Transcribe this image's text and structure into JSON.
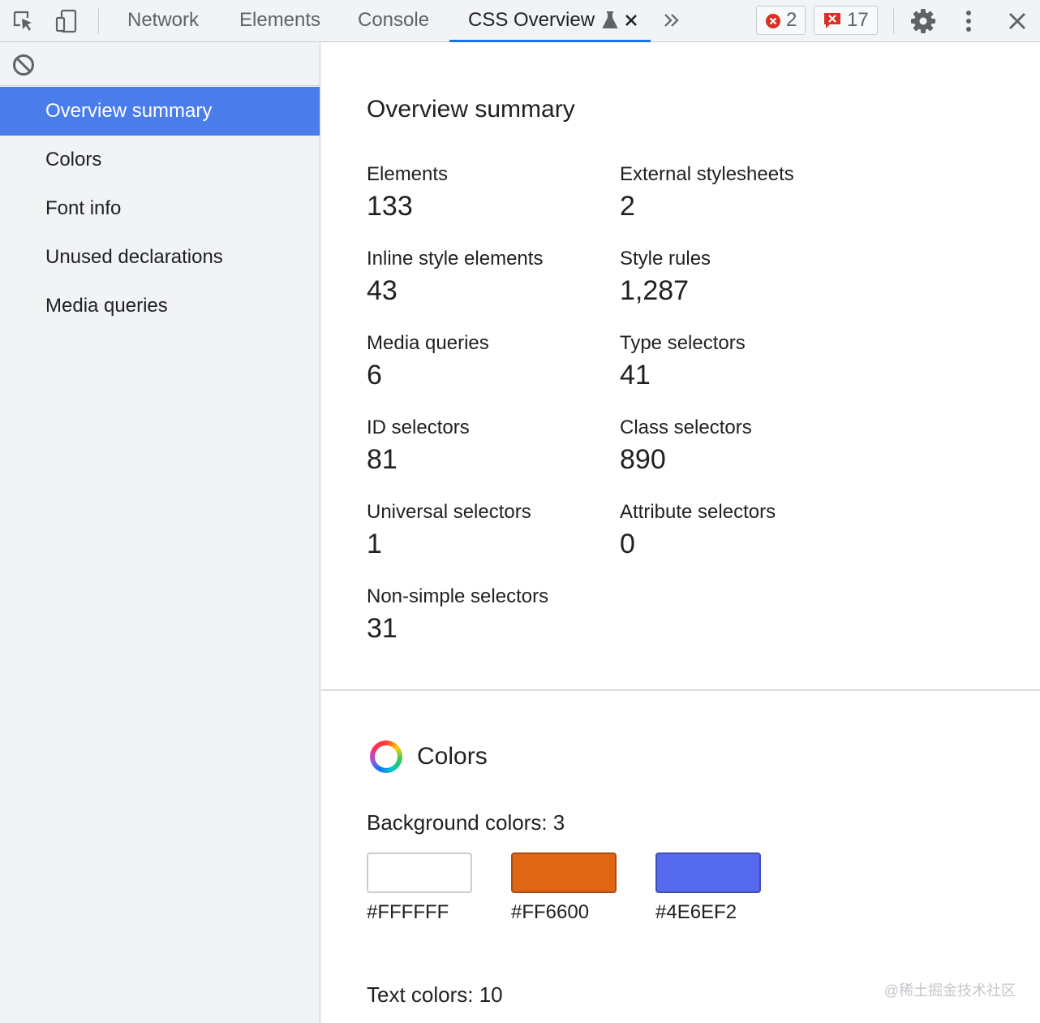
{
  "toolbar": {
    "tabs": [
      {
        "label": "Network"
      },
      {
        "label": "Elements"
      },
      {
        "label": "Console"
      },
      {
        "label": "CSS Overview"
      }
    ],
    "error_count": "2",
    "issue_count": "17",
    "icons": [
      "inspect-element-icon",
      "device-toggle-icon",
      "experiment-flask-icon",
      "close-tab-icon",
      "more-tabs-icon",
      "error-icon",
      "issue-icon",
      "gear-icon",
      "more-vert-icon",
      "close-icon"
    ]
  },
  "sidebar": {
    "clear_icon": "block-icon",
    "items": [
      {
        "label": "Overview summary",
        "active": true
      },
      {
        "label": "Colors"
      },
      {
        "label": "Font info"
      },
      {
        "label": "Unused declarations"
      },
      {
        "label": "Media queries"
      }
    ]
  },
  "main": {
    "title": "Overview summary",
    "stats": [
      {
        "label": "Elements",
        "value": "133"
      },
      {
        "label": "External stylesheets",
        "value": "2"
      },
      {
        "label": "Inline style elements",
        "value": "43"
      },
      {
        "label": "Style rules",
        "value": "1,287"
      },
      {
        "label": "Media queries",
        "value": "6"
      },
      {
        "label": "Type selectors",
        "value": "41"
      },
      {
        "label": "ID selectors",
        "value": "81"
      },
      {
        "label": "Class selectors",
        "value": "890"
      },
      {
        "label": "Universal selectors",
        "value": "1"
      },
      {
        "label": "Attribute selectors",
        "value": "0"
      },
      {
        "label": "Non-simple selectors",
        "value": "31"
      }
    ],
    "colors": {
      "title": "Colors",
      "background_heading": "Background colors: 3",
      "background": [
        {
          "hex": "#FFFFFF",
          "fill": "#ffffff"
        },
        {
          "hex": "#FF6600",
          "fill": "#e06616"
        },
        {
          "hex": "#4E6EF2",
          "fill": "#5469ed"
        }
      ],
      "text_heading": "Text colors: 10"
    }
  },
  "watermark": "@稀土掘金技术社区",
  "colors": {
    "accent": "#1a73e8",
    "selected": "#4a7cea",
    "error": "#d93025"
  }
}
